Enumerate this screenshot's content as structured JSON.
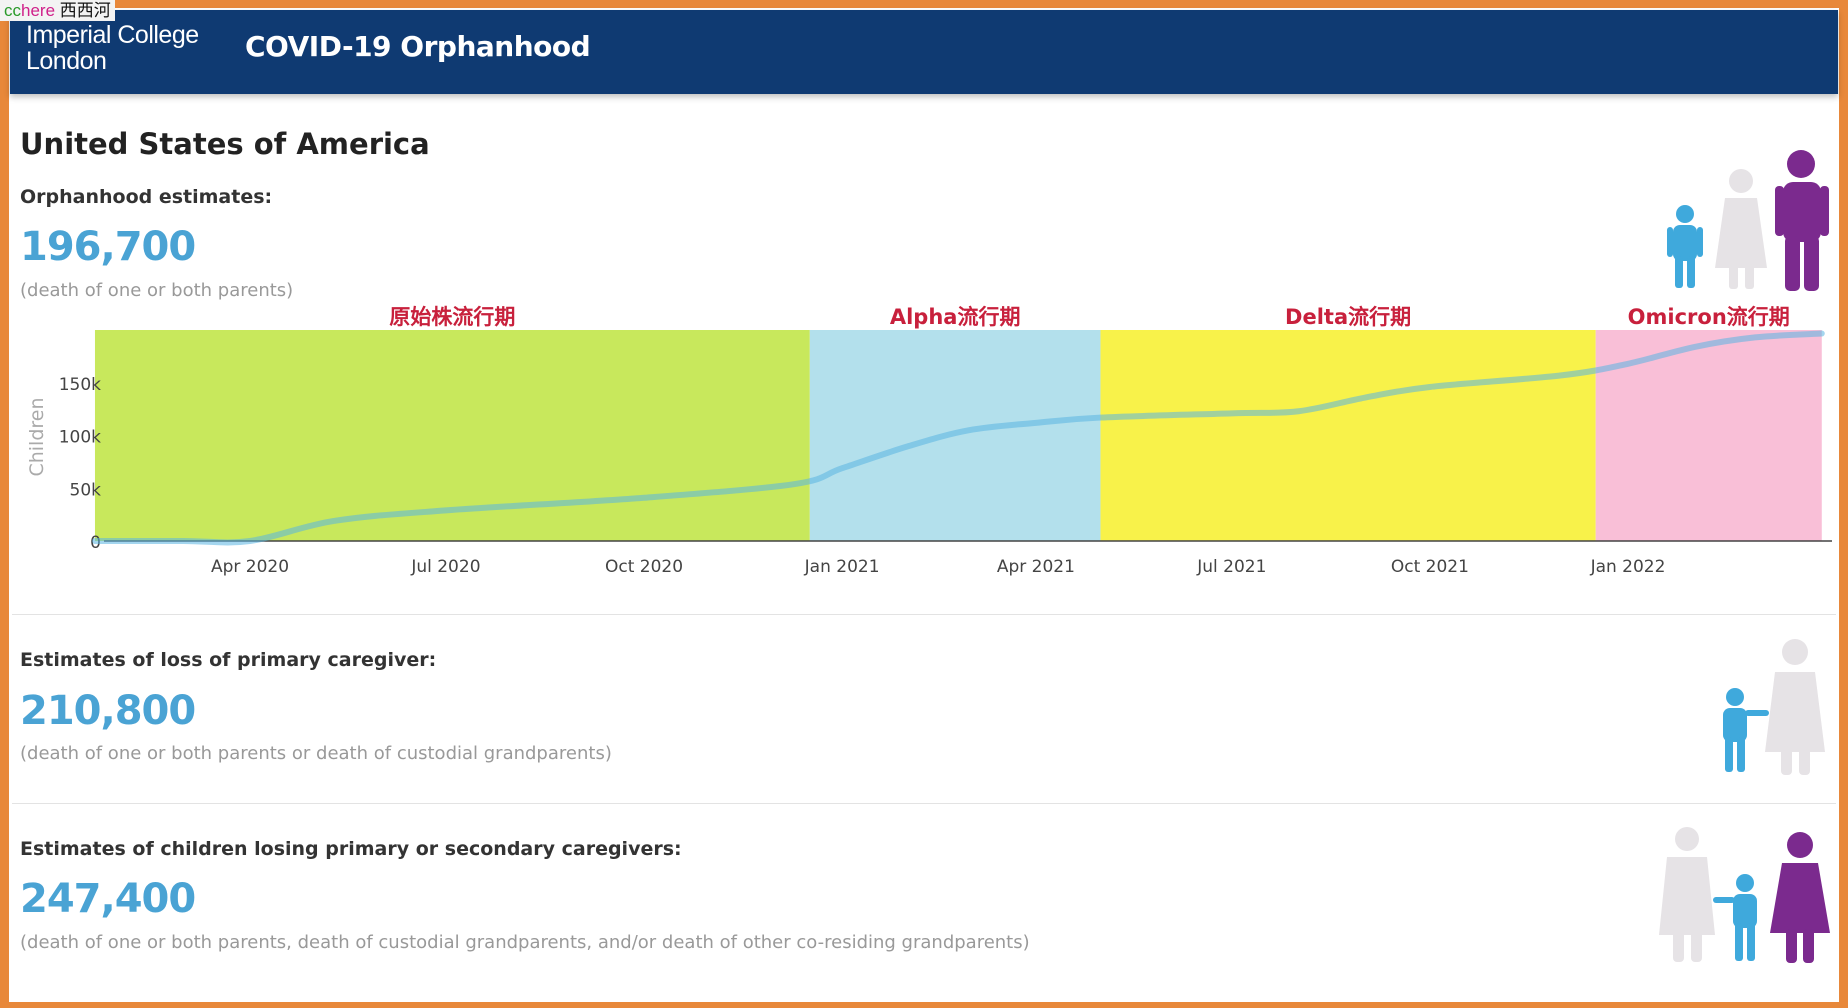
{
  "watermark": {
    "part1": "cc",
    "part2": "here",
    "part3": "西西河"
  },
  "header": {
    "logo_line1": "Imperial College",
    "logo_line2": "London",
    "title": "COVID-19 Orphanhood"
  },
  "country": "United States of America",
  "sections": [
    {
      "label": "Orphanhood estimates:",
      "value": "196,700",
      "note": "(death of one or both parents)",
      "icon": "parents-and-child-icon"
    },
    {
      "label": "Estimates of loss of primary caregiver:",
      "value": "210,800",
      "note": "(death of one or both parents or death of custodial grandparents)",
      "icon": "grandparent-and-child-icon"
    },
    {
      "label": "Estimates of children losing primary or secondary caregivers:",
      "value": "247,400",
      "note": "(death of one or both parents, death of custodial grandparents, and/or death of other co-residing grandparents)",
      "icon": "grandparent-child-parent-icon"
    }
  ],
  "colors": {
    "header": "#0f3a72",
    "value": "#4aa3d4",
    "child": "#3fa9dc",
    "adult_female_gray": "#e4e2e4",
    "adult_purple": "#7b2a8e",
    "period_label": "#c8203c"
  },
  "chart_data": {
    "type": "line",
    "ylabel": "Children",
    "xlabel": "",
    "ylim": [
      0,
      200000
    ],
    "yticks": [
      0,
      50000,
      100000,
      150000
    ],
    "ytick_labels": [
      "0",
      "50k",
      "100k",
      "150k"
    ],
    "xticks": [
      "2020-04-01",
      "2020-07-01",
      "2020-10-01",
      "2021-01-01",
      "2021-04-01",
      "2021-07-01",
      "2021-10-01",
      "2022-01-01"
    ],
    "xtick_labels": [
      "Apr 2020",
      "Jul 2020",
      "Oct 2020",
      "Jan 2021",
      "Apr 2021",
      "Jul 2021",
      "Oct 2021",
      "Jan 2022"
    ],
    "grid": false,
    "series": [
      {
        "x": [
          "2020-01-20",
          "2020-03-01",
          "2020-04-01",
          "2020-05-10",
          "2020-07-01",
          "2020-10-01",
          "2020-12-10",
          "2021-01-01",
          "2021-02-01",
          "2021-03-01",
          "2021-04-01",
          "2021-05-01",
          "2021-07-01",
          "2021-08-01",
          "2021-09-01",
          "2021-10-01",
          "2021-12-01",
          "2022-01-01",
          "2022-02-01",
          "2022-03-01",
          "2022-04-01"
        ],
        "y": [
          0,
          0,
          0,
          19000,
          29000,
          41000,
          54000,
          69000,
          90000,
          105000,
          112000,
          117000,
          121000,
          123000,
          136000,
          146000,
          157000,
          168000,
          184000,
          193000,
          196700
        ]
      }
    ],
    "periods": [
      {
        "label": "原始株流行期",
        "start": "2020-01-20",
        "end": "2020-12-17",
        "color": "#c8e85c"
      },
      {
        "label": "Alpha流行期",
        "start": "2020-12-17",
        "end": "2021-05-01",
        "color": "#b3e0ec"
      },
      {
        "label": "Delta流行期",
        "start": "2021-05-01",
        "end": "2021-12-17",
        "color": "#f8f24a"
      },
      {
        "label": "Omicron流行期",
        "start": "2021-12-17",
        "end": "2022-04-01",
        "color": "#f9bfd7"
      }
    ]
  }
}
